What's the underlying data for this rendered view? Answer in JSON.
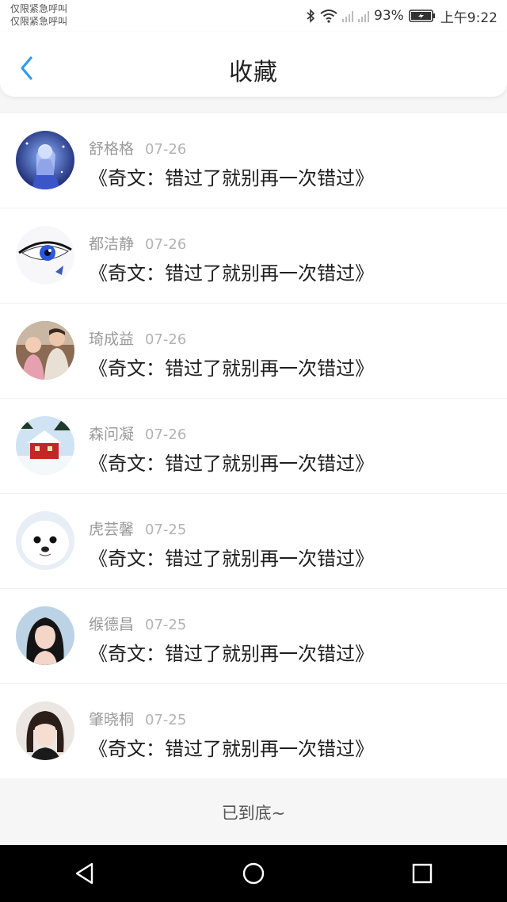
{
  "status_bar": {
    "carrier_line1": "仅限紧急呼叫",
    "carrier_line2": "仅限紧急呼叫",
    "battery_percent": "93%",
    "time": "上午9:22",
    "icons": [
      "bluetooth-icon",
      "wifi-icon",
      "signal-icon",
      "signal-icon",
      "battery-icon"
    ]
  },
  "header": {
    "title": "收藏",
    "back_icon": "chevron-left-icon",
    "accent_color": "#2e9cf2"
  },
  "favorites": [
    {
      "name": "舒格格",
      "date": "07-26",
      "title": "《奇文：错过了就别再一次错过》",
      "avatar": "anime-girl-blue"
    },
    {
      "name": "都洁静",
      "date": "07-26",
      "title": "《奇文：错过了就别再一次错过》",
      "avatar": "blue-eye"
    },
    {
      "name": "琦成益",
      "date": "07-26",
      "title": "《奇文：错过了就别再一次错过》",
      "avatar": "two-children"
    },
    {
      "name": "森问凝",
      "date": "07-26",
      "title": "《奇文：错过了就别再一次错过》",
      "avatar": "red-house-snow"
    },
    {
      "name": "虎芸馨",
      "date": "07-25",
      "title": "《奇文：错过了就别再一次错过》",
      "avatar": "white-seal"
    },
    {
      "name": "缑德昌",
      "date": "07-25",
      "title": "《奇文：错过了就别再一次错过》",
      "avatar": "dark-hair-girl"
    },
    {
      "name": "肇晓桐",
      "date": "07-25",
      "title": "《奇文：错过了就别再一次错过》",
      "avatar": "girl-portrait"
    }
  ],
  "list_end_text": "已到底~",
  "nav_bar": {
    "buttons": [
      "back-triangle-icon",
      "home-circle-icon",
      "recents-square-icon"
    ]
  }
}
